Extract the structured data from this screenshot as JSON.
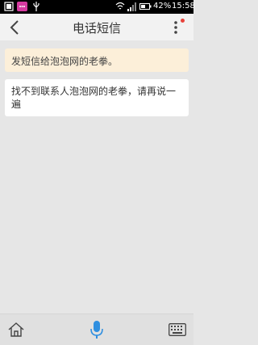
{
  "status_bar": {
    "battery_percent": "42%",
    "time": "15:58",
    "icons": [
      "notification-square-icon",
      "chat-bubble-icon",
      "usb-icon",
      "wifi-icon",
      "signal-icon",
      "battery-icon"
    ]
  },
  "header": {
    "title": "电话短信",
    "back_icon": "back-chevron-icon",
    "menu_icon": "more-vertical-icon",
    "has_notification": true,
    "notification_color": "#e8423b"
  },
  "conversation": {
    "user_message": "发短信给泡泡网的老拳。",
    "bot_message": "找不到联系人泡泡网的老拳，请再说一遍"
  },
  "bottom_bar": {
    "home_icon": "home-icon",
    "mic_icon": "microphone-icon",
    "keyboard_icon": "keyboard-icon",
    "mic_color": "#2f8fe0"
  },
  "colors": {
    "user_bubble": "#fcefd9",
    "bot_bubble": "#ffffff",
    "background": "#e6e6e6"
  }
}
